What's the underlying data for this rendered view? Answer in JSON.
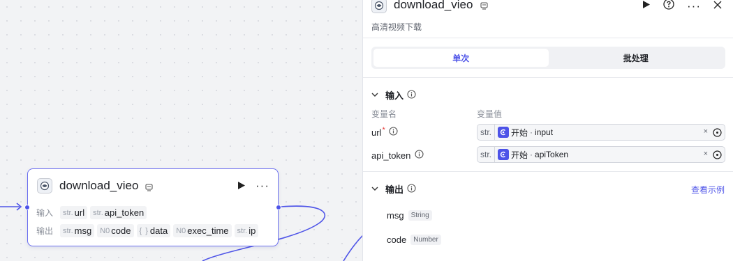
{
  "node": {
    "title": "download_vieo",
    "inputs_label": "输入",
    "outputs_label": "输出",
    "inputs": [
      {
        "type": "str.",
        "name": "url"
      },
      {
        "type": "str.",
        "name": "api_token"
      }
    ],
    "outputs": [
      {
        "type": "str.",
        "name": "msg"
      },
      {
        "type": "N0",
        "name": "code"
      },
      {
        "type": "{ }",
        "name": "data"
      },
      {
        "type": "N0",
        "name": "exec_time"
      },
      {
        "type": "str.",
        "name": "ip"
      }
    ]
  },
  "panel": {
    "title": "download_vieo",
    "subtitle": "高清视频下载",
    "tabs": [
      {
        "label": "单次",
        "active": true
      },
      {
        "label": "批处理",
        "active": false
      }
    ],
    "input_section": "输入",
    "col_name": "变量名",
    "col_value": "变量值",
    "inputs": [
      {
        "name": "url",
        "required": "*",
        "type": "str.",
        "ref_node": "开始",
        "ref_sep": "·",
        "ref_var": "input",
        "clear": "×"
      },
      {
        "name": "api_token",
        "required": "",
        "type": "str.",
        "ref_node": "开始",
        "ref_sep": "·",
        "ref_var": "apiToken",
        "clear": "×"
      }
    ],
    "output_section": "输出",
    "view_example": "查看示例",
    "outputs": [
      {
        "name": "msg",
        "type": "String"
      },
      {
        "name": "code",
        "type": "Number"
      }
    ]
  },
  "colors": {
    "accent": "#4d53e8",
    "node_border": "#6b6ef0",
    "edge": "#5056e8"
  }
}
